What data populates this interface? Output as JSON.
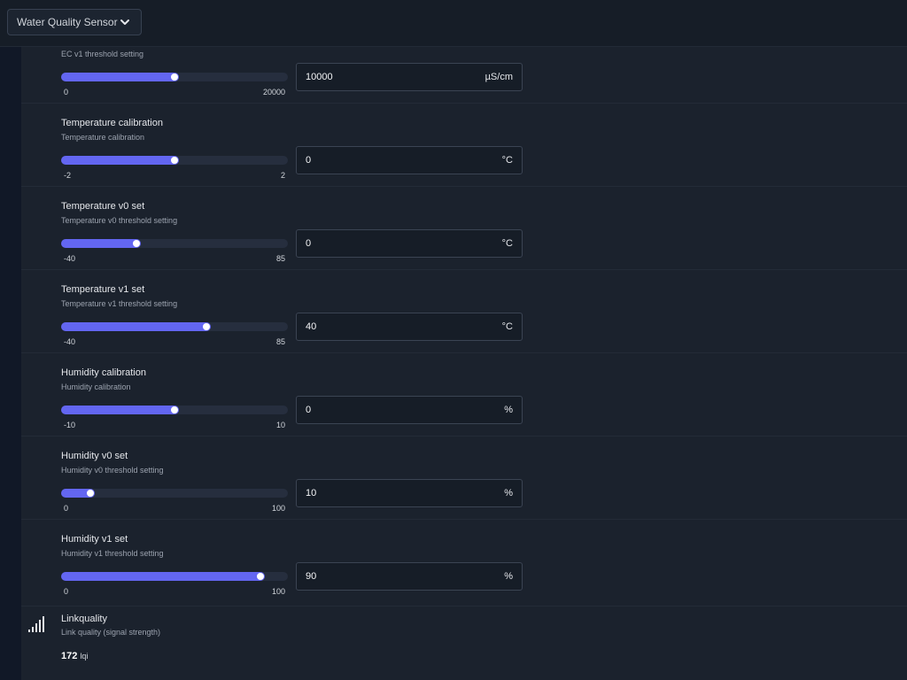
{
  "header": {
    "device_select": {
      "value": "Water Quality Sensor"
    }
  },
  "settings": [
    {
      "title": "",
      "desc": "EC v1 threshold setting",
      "min": "0",
      "max": "20000",
      "value": "10000",
      "unit": "µS/cm",
      "fill_fraction": 0.52
    },
    {
      "title": "Temperature calibration",
      "desc": "Temperature calibration",
      "min": "-2",
      "max": "2",
      "value": "0",
      "unit": "°C",
      "fill_fraction": 0.52
    },
    {
      "title": "Temperature v0 set",
      "desc": "Temperature v0 threshold setting",
      "min": "-40",
      "max": "85",
      "value": "0",
      "unit": "°C",
      "fill_fraction": 0.35
    },
    {
      "title": "Temperature v1 set",
      "desc": "Temperature v1 threshold setting",
      "min": "-40",
      "max": "85",
      "value": "40",
      "unit": "°C",
      "fill_fraction": 0.66
    },
    {
      "title": "Humidity calibration",
      "desc": "Humidity calibration",
      "min": "-10",
      "max": "10",
      "value": "0",
      "unit": "%",
      "fill_fraction": 0.52
    },
    {
      "title": "Humidity v0 set",
      "desc": "Humidity v0 threshold setting",
      "min": "0",
      "max": "100",
      "value": "10",
      "unit": "%",
      "fill_fraction": 0.15
    },
    {
      "title": "Humidity v1 set",
      "desc": "Humidity v1 threshold setting",
      "min": "0",
      "max": "100",
      "value": "90",
      "unit": "%",
      "fill_fraction": 0.9
    }
  ],
  "linkquality": {
    "title": "Linkquality",
    "desc": "Link quality (signal strength)",
    "value": "172",
    "unit": "lqi",
    "icon": "signal-bars-icon"
  },
  "colors": {
    "accent": "#6366f1",
    "background": "#111827",
    "panel": "#1b222d"
  }
}
